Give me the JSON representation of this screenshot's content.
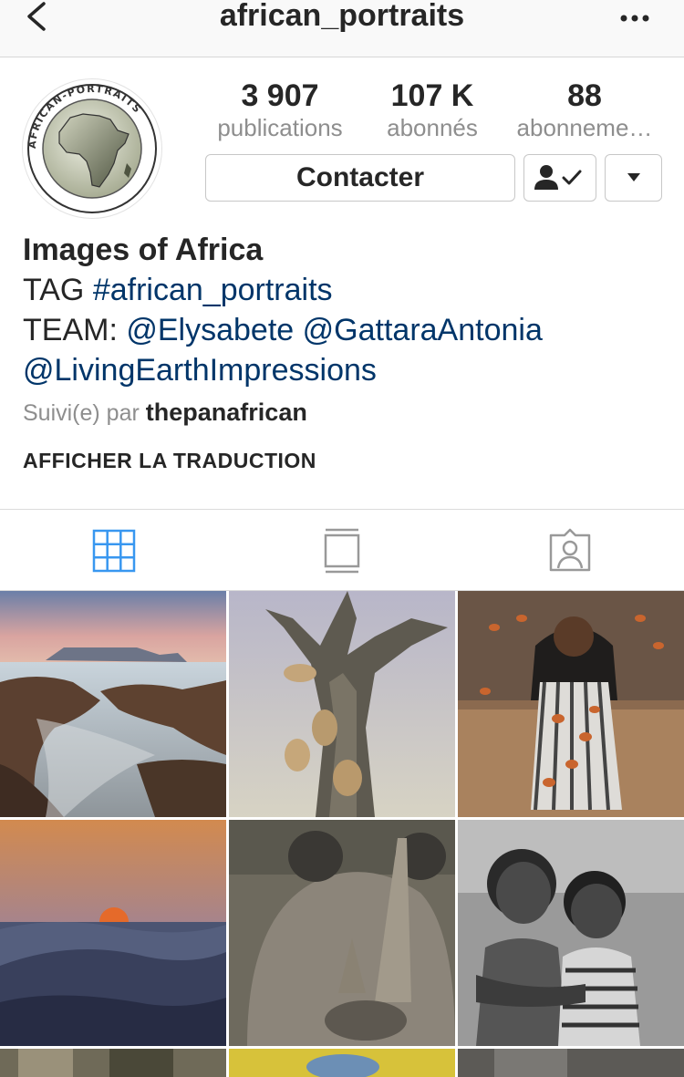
{
  "nav": {
    "username": "african_portraits",
    "back_icon": "chevron-left-icon",
    "more_icon": "more-horizontal-icon"
  },
  "profile": {
    "avatar_text": "AFRICAN-PORTRAITS",
    "stats": [
      {
        "count": "3 907",
        "label": "publications"
      },
      {
        "count": "107 K",
        "label": "abonnés"
      },
      {
        "count": "88",
        "label": "abonneme…"
      }
    ],
    "contact_button": "Contacter",
    "following_icon": "person-check-icon",
    "dropdown_icon": "triangle-down-icon"
  },
  "bio": {
    "name": "Images of Africa",
    "tag_prefix": "TAG ",
    "hashtag": "#african_portraits",
    "team_prefix": "TEAM: ",
    "mentions": [
      "@Elysabete",
      "@GattaraAntonia",
      "@LivingEarthImpressions"
    ],
    "followed_by_label": "Suivi(e) par",
    "followed_by_user": "thepanafrican",
    "translate": "AFFICHER LA TRADUCTION"
  },
  "tabs": [
    {
      "name": "grid-view",
      "icon": "grid-icon",
      "active": true
    },
    {
      "name": "feed-view",
      "icon": "portrait-feed-icon",
      "active": false
    },
    {
      "name": "tagged-view",
      "icon": "tagged-person-icon",
      "active": false
    }
  ],
  "colors": {
    "link": "#003569",
    "active_tab": "#3897f0",
    "inactive_tab": "#999999",
    "muted": "#8e8e8e"
  },
  "posts": [
    {
      "subject": "coastal rocks with Table Mountain at dusk"
    },
    {
      "subject": "cheetah cubs climbing a tree"
    },
    {
      "subject": "smiling girl in hijab throwing cocoa beans"
    },
    {
      "subject": "sunset over desert dunes"
    },
    {
      "subject": "rhinoceros close-up"
    },
    {
      "subject": "two children, black and white"
    },
    {
      "subject": "partial photo"
    },
    {
      "subject": "partial photo"
    },
    {
      "subject": "partial photo"
    }
  ]
}
